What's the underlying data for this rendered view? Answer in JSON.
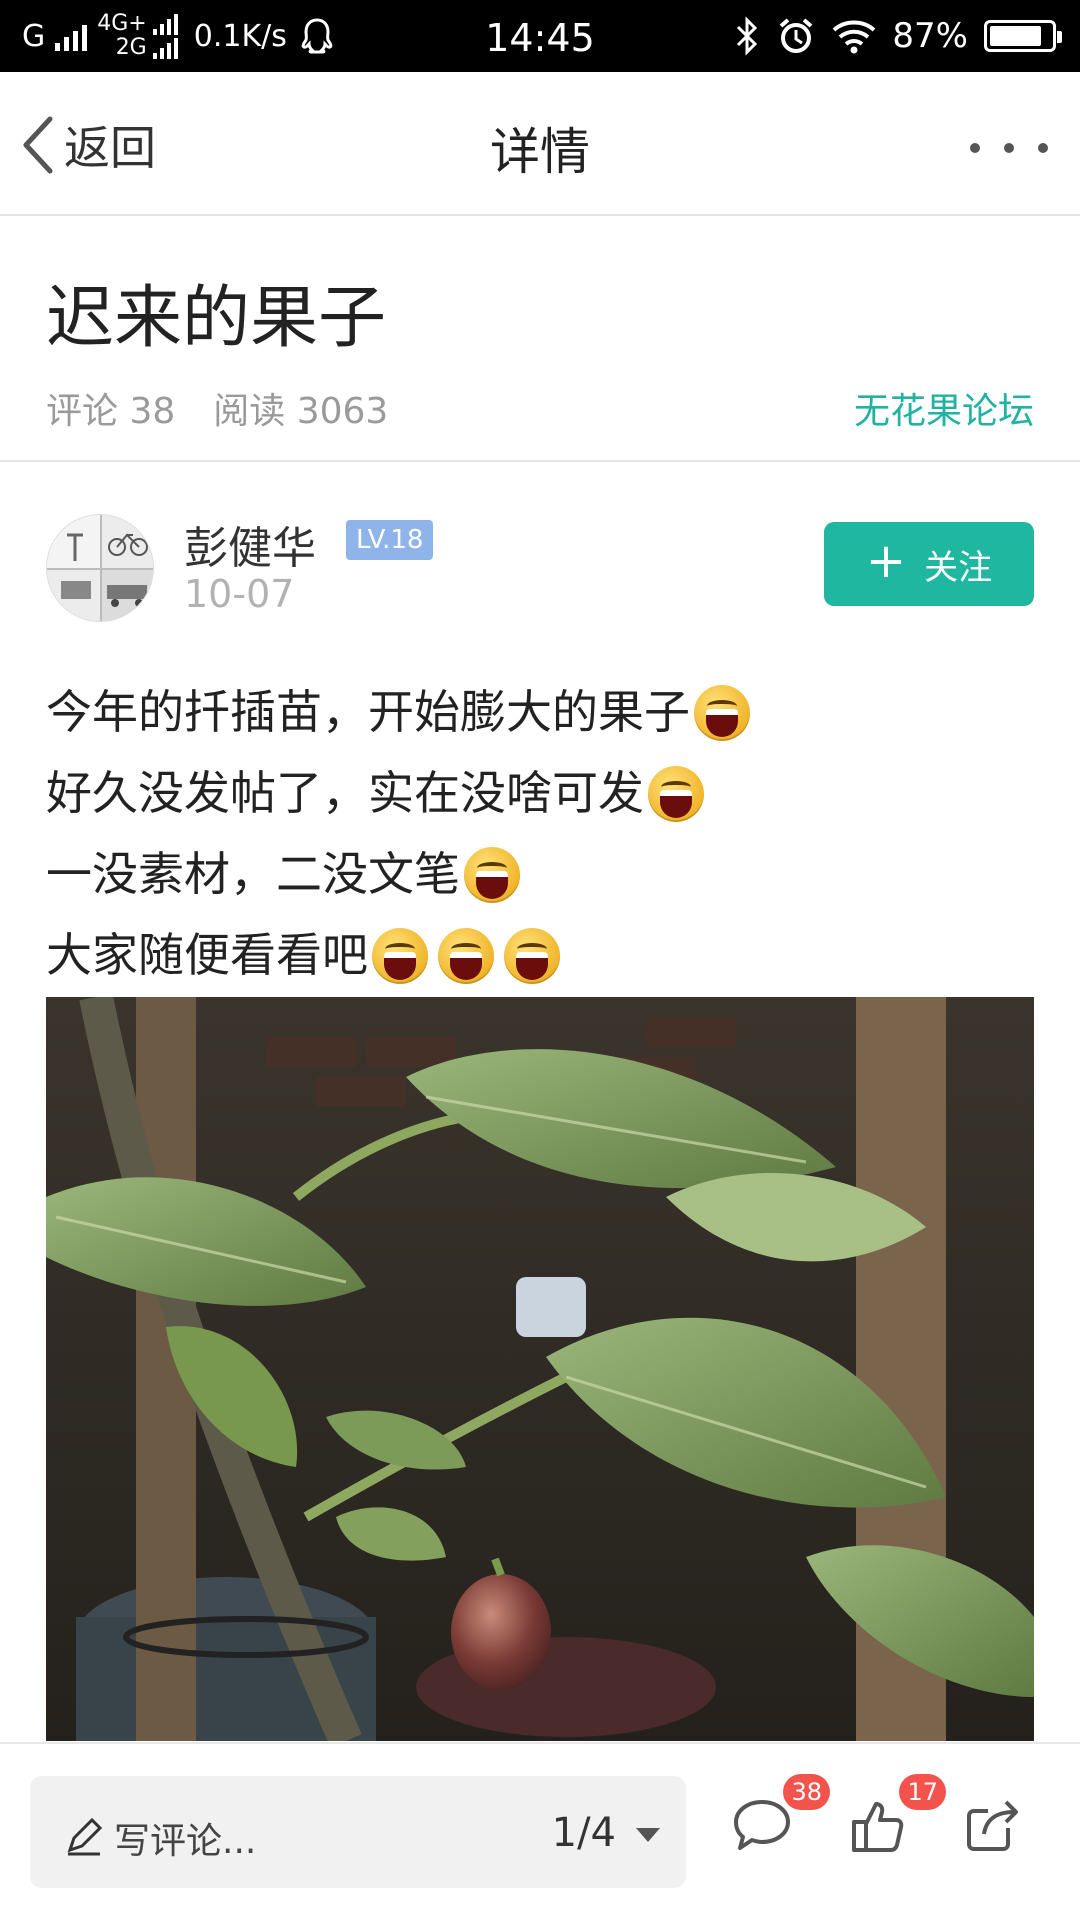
{
  "status_bar": {
    "carrier1": "G",
    "carrier2": "4G+",
    "carrier3": "2G",
    "speed": "0.1K/s",
    "time": "14:45",
    "battery_text": "87%",
    "battery_level": 0.87
  },
  "nav": {
    "back_label": "返回",
    "title": "详情"
  },
  "post": {
    "title": "迟来的果子",
    "comments_label": "评论 38",
    "reads_label": "阅读 3063",
    "forum": "无花果论坛",
    "author": "彭健华",
    "level": "LV.18",
    "date": "10-07",
    "follow_label": "关注",
    "lines": [
      "今年的扦插苗，开始膨大的果子",
      "好久没发帖了，实在没啥可发",
      "一没素材，二没文笔",
      "大家随便看看吧"
    ]
  },
  "bottom": {
    "comment_placeholder": "写评论...",
    "pager": "1/4",
    "comment_count": "38",
    "like_count": "17"
  },
  "colors": {
    "accent": "#1fb7a0",
    "level_badge": "#8fb4ea",
    "count_badge": "#f2534d"
  }
}
